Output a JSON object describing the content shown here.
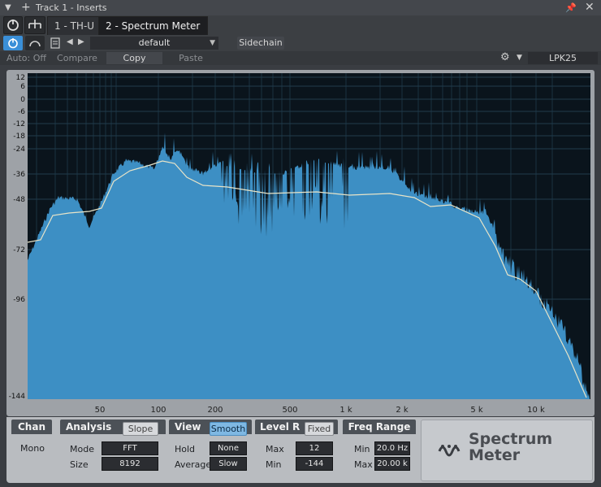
{
  "window": {
    "title": "Track 1 - Inserts",
    "pin_icon": "pin-icon",
    "close_icon": "close-icon"
  },
  "tabs": {
    "power_icon": "power-icon",
    "routing_icon": "routing-icon",
    "items": [
      "1 - TH-U",
      "2 - Spectrum Meter"
    ]
  },
  "preset": {
    "power_icon": "power-icon",
    "compare_icon": "compare-icon",
    "name": "default",
    "sidechain_label": "Sidechain"
  },
  "actions": {
    "auto": "Auto: Off",
    "compare": "Compare",
    "copy": "Copy",
    "paste": "Paste",
    "device": "LPK25"
  },
  "chart_data": {
    "type": "area",
    "y_ticks": [
      "12",
      "6",
      "0",
      "-6",
      "-12",
      "-18",
      "-24",
      "-36",
      "-48",
      "-72",
      "-96",
      "-144"
    ],
    "x_ticks": [
      "50",
      "100",
      "200",
      "500",
      "1 k",
      "2 k",
      "5 k",
      "10 k"
    ],
    "ylabel": "",
    "xlabel": "",
    "colors": {
      "fill": "#3d8fc4",
      "smooth": "#e8e4c8",
      "bg": "#0a141c",
      "grid": "#2a4a5e"
    }
  },
  "panel": {
    "chan": {
      "title": "Chan",
      "value": "Mono"
    },
    "analysis": {
      "title": "Analysis",
      "toggle": "Slope",
      "mode_label": "Mode",
      "mode": "FFT",
      "size_label": "Size",
      "size": "8192"
    },
    "view": {
      "title": "View",
      "toggle": "Smooth",
      "hold_label": "Hold",
      "hold": "None",
      "avg_label": "Average",
      "avg": "Slow"
    },
    "level": {
      "title": "Level R",
      "toggle": "Fixed",
      "max_label": "Max",
      "max": "12",
      "min_label": "Min",
      "min": "-144"
    },
    "freq": {
      "title": "Freq Range",
      "min_label": "Min",
      "min": "20.0 Hz",
      "max_label": "Max",
      "max": "20.00 k"
    },
    "logo": {
      "line1": "Spectrum",
      "line2": "Meter"
    }
  }
}
